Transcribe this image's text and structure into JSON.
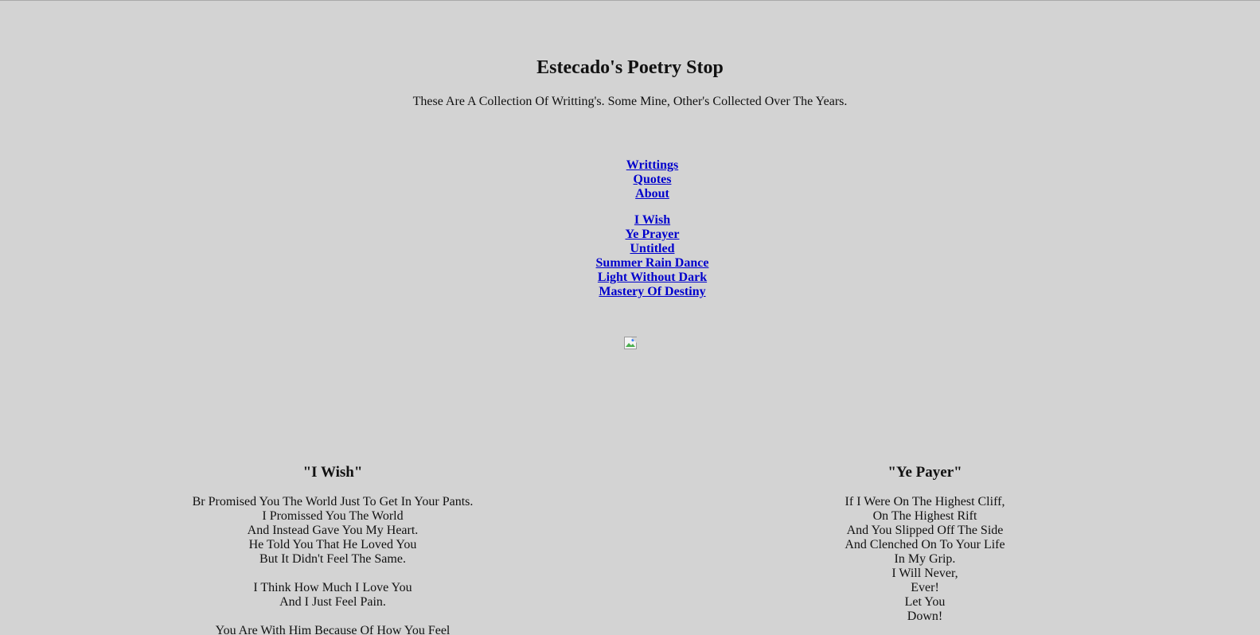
{
  "header": {
    "title": "Estecado's Poetry Stop",
    "subtitle": "These Are A Collection Of Writting's. Some Mine, Other's Collected Over The Years."
  },
  "nav_main": [
    "Writtings",
    "Quotes",
    "About"
  ],
  "nav_poems": [
    "I Wish",
    "Ye Prayer",
    "Untitled",
    "Summer Rain Dance",
    "Light Without Dark",
    "Mastery Of Destiny"
  ],
  "image": {
    "icon": "broken-image-icon"
  },
  "poems": {
    "left": {
      "title": "\"I Wish\"",
      "stanzas": [
        [
          "Br Promised You The World Just To Get In Your Pants.",
          "I Promissed You The World",
          "And Instead Gave You My Heart.",
          "He Told You That He Loved You",
          "But It Didn't Feel The Same."
        ],
        [
          "I Think How Much I Love You",
          "And I Just Feel Pain."
        ],
        [
          "You Are With Him Because Of How You Feel"
        ]
      ]
    },
    "right": {
      "title": "\"Ye Payer\"",
      "stanzas": [
        [
          "If I Were On The Highest Cliff,",
          "On The Highest Rift",
          "And You Slipped Off The Side",
          "And Clenched On To Your Life",
          "In My Grip.",
          "I Will Never,",
          "Ever!",
          "Let You",
          "Down!"
        ]
      ]
    }
  }
}
